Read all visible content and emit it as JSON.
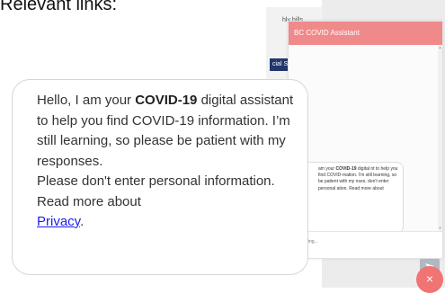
{
  "top_text": "Relevant links:",
  "background_page": {
    "snippet_text": "hly bills",
    "button_text": "cial S"
  },
  "chat": {
    "title": "BC COVID Assistant",
    "mini_message": {
      "line1_prefix": "am your ",
      "line1_bold": "COVID-19",
      "line1_suffix": " digital",
      "rest": "nt to help you find COVID-mation. I'm still learning, so be patient with my nses. don't enter personal ation. Read more about"
    },
    "input_placeholder": "rthing..."
  },
  "welcome": {
    "p1_prefix": "Hello, I am your ",
    "p1_bold": "COVID-19",
    "p1_suffix": " digital assistant to help you find COVID-19 information. I’m still learning, so please be patient with my responses.",
    "p2": "Please don't enter personal information. Read more about",
    "link_label": "Privacy",
    "link_suffix": "."
  },
  "icons": {
    "close": "×",
    "send": "send-icon",
    "scroll_up": "▲",
    "scroll_down": "▼"
  },
  "colors": {
    "header": "#f08a8a",
    "close_button": "#f07474",
    "link": "#1d1df0"
  }
}
